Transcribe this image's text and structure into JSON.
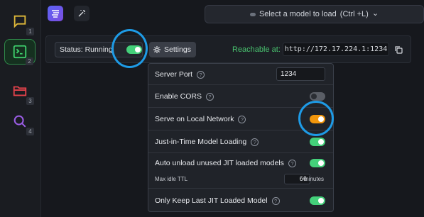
{
  "sidebar": {
    "items": [
      {
        "name": "chat",
        "num": "1",
        "icon": "chat-icon",
        "color": "#e0b93a"
      },
      {
        "name": "developer",
        "num": "2",
        "icon": "terminal-icon",
        "color": "#3fd06d",
        "active": true
      },
      {
        "name": "models",
        "num": "3",
        "icon": "folder-icon",
        "color": "#e2424b"
      },
      {
        "name": "discover",
        "num": "4",
        "icon": "search-icon",
        "color": "#9b5de5"
      }
    ]
  },
  "topbar": {
    "model_select_label": "Select a model to load",
    "model_select_shortcut": "(Ctrl +L)",
    "chevron": "⌄"
  },
  "server": {
    "status_label": "Status: Running",
    "status_on": true,
    "settings_label": "Settings",
    "reachable_label": "Reachable at:",
    "url": "http://172.17.224.1:1234"
  },
  "settings_panel": {
    "server_port_label": "Server Port",
    "server_port_value": "1234",
    "enable_cors_label": "Enable CORS",
    "enable_cors_on": false,
    "serve_local_label": "Serve on Local Network",
    "serve_local_on": true,
    "jit_label": "Just-in-Time Model Loading",
    "jit_on": true,
    "auto_unload_label": "Auto unload unused JIT loaded models",
    "auto_unload_on": true,
    "max_idle_label": "Max idle TTL",
    "max_idle_value": "60",
    "max_idle_unit": "minutes",
    "only_keep_label": "Only Keep Last JIT Loaded Model",
    "only_keep_on": true,
    "help_glyph": "?"
  },
  "colors": {
    "accent_green": "#44d07a",
    "accent_orange": "#f2960c",
    "annotation_blue": "#1e9be6"
  }
}
